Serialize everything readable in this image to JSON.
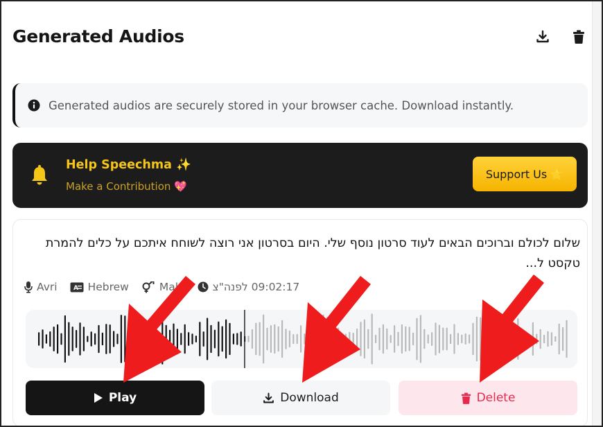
{
  "header": {
    "title": "Generated Audios",
    "icons": [
      "download-icon",
      "trash-icon"
    ]
  },
  "notice": {
    "icon": "info-icon",
    "text": "Generated audios are securely stored in your browser cache. Download instantly."
  },
  "promo": {
    "icon": "bell-icon",
    "title": "Help Speechma ✨",
    "subtitle": "Make a Contribution 💖",
    "button_label": "Support Us",
    "button_icon": "⭐",
    "colors": {
      "background": "#1c1c1c",
      "accent": "#f5c518"
    }
  },
  "audio_card": {
    "text": "שלום לכולם וברוכים הבאים לעוד סרטון נוסף שלי. היום בסרטון אני רוצה לשוחח איתכם על כלים להמרת טקסט ל...",
    "meta": {
      "voice": "Avri",
      "language": "Hebrew",
      "gender": "Male",
      "time": "09:02:17 לפנה\"צ"
    },
    "playback_progress": 0.39,
    "actions": {
      "play": "Play",
      "download": "Download",
      "delete": "Delete"
    },
    "colors": {
      "delete": "#e8294f",
      "play_bg": "#151515"
    }
  },
  "annotation": {
    "arrow_color": "#ee1c1c",
    "arrow_count": 3
  }
}
